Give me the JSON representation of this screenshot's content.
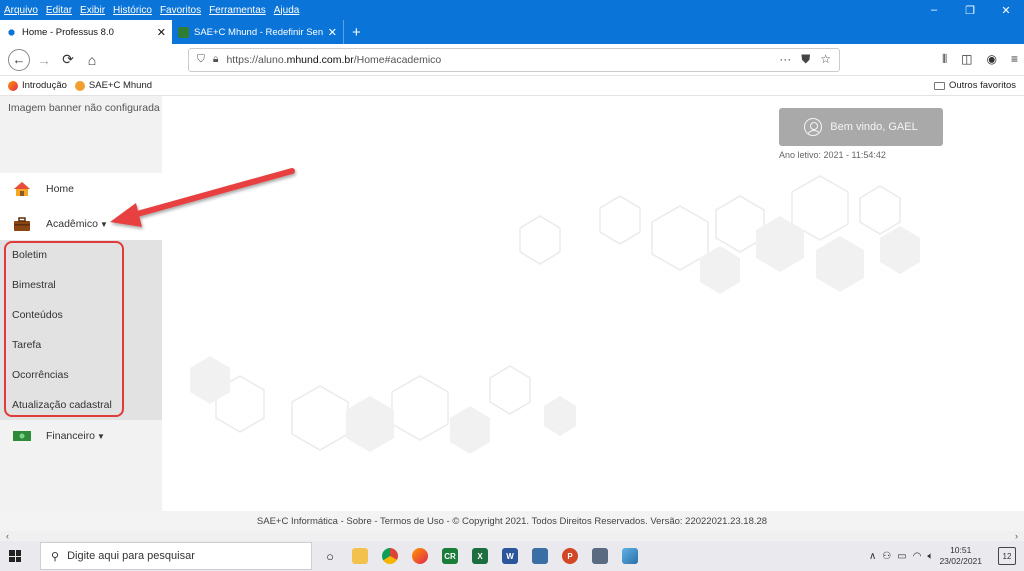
{
  "browser": {
    "menu": [
      "Arquivo",
      "Editar",
      "Exibir",
      "Histórico",
      "Favoritos",
      "Ferramentas",
      "Ajuda"
    ],
    "window_controls": {
      "minimize": "–",
      "maximize": "❐",
      "close": "✕"
    },
    "tabs": [
      {
        "title": "Home - Professus 8.0",
        "close": "✕"
      },
      {
        "title": "SAE+C Mhund - Redefinir Senh",
        "close": "✕"
      }
    ],
    "new_tab": "+",
    "url": {
      "prefix": "https://aluno.",
      "host": "mhund.com.br",
      "path": "/Home#academico"
    },
    "bookmarks": [
      "Introdução",
      "SAE+C Mhund"
    ],
    "other_bookmarks": "Outros favoritos"
  },
  "sidebar": {
    "banner": "Imagem banner não configurada",
    "home": "Home",
    "academico": "Acadêmico",
    "submenu": [
      "Boletim",
      "Bimestral",
      "Conteúdos",
      "Tarefa",
      "Ocorrências",
      "Atualização cadastral"
    ],
    "financeiro": "Financeiro"
  },
  "header": {
    "welcome": "Bem vindo, GAEL",
    "ano_letivo": "Ano letivo: 2021 - 11:54:42"
  },
  "footer": "SAE+C Informática - Sobre - Termos de Uso - © Copyright 2021. Todos Direitos Reservados. Versão: 22022021.23.18.28",
  "taskbar": {
    "search_placeholder": "Digite aqui para pesquisar",
    "time": "10:51",
    "date": "23/02/2021",
    "notifications": "12"
  },
  "colors": {
    "browser_blue": "#0a74d9",
    "highlight_red": "#e03a3a",
    "welcome_bg": "#a9a9a9"
  }
}
